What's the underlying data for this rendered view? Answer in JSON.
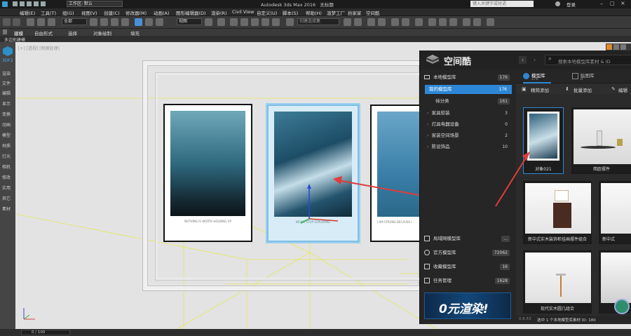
{
  "titlebar": {
    "workspace_label": "工作区: 默认",
    "app_title": "Autodesk 3ds Max 2016",
    "doc_title": "无标题",
    "search_placeholder": "键入关键字或短语",
    "login": "登录"
  },
  "menubar": {
    "items": [
      "编辑(E)",
      "工具(T)",
      "组(G)",
      "视图(V)",
      "创建(C)",
      "修改器(M)",
      "动画(A)",
      "图形编辑器(D)",
      "渲染(R)",
      "Civil View",
      "自定义(U)",
      "脚本(S)",
      "帮助(H)",
      "渲梦工厂",
      "扮家家",
      "空间酷"
    ]
  },
  "toolbar": {
    "filter_value": "全部",
    "view_value": "视图",
    "selset_placeholder": "创建选择集"
  },
  "ribbon": {
    "tabs": [
      "建模",
      "自由形式",
      "选择",
      "对象绘制",
      "填充"
    ],
    "sub_label": "多边形建模"
  },
  "leftpanel": {
    "items": [
      "3DF2",
      "渲染",
      "文件",
      "编辑",
      "显示",
      "变换",
      "动画",
      "模型",
      "材质",
      "灯光",
      "相机",
      "修改",
      "实用",
      "其它",
      "素材"
    ]
  },
  "viewport": {
    "label": "[+] [透视] [明暗处理]",
    "caption_1": "NOTHING IS WORTH HOLDING UP",
    "caption_2": "NEVER STOP EXPLORING",
    "caption_3": "I AM STRONG BECAUSE I..."
  },
  "statusbar": {
    "frame": "0 / 100"
  },
  "plugin": {
    "brand": "空间酷",
    "search_placeholder": "搜索本地模型库素材 & ID",
    "tab_model": "模型库",
    "tab_model_count": "176",
    "tab_texture": "贴图库",
    "tab_texture_count": "0",
    "btn_quick": "精简添加",
    "btn_batch": "批量添加",
    "btn_edit": "编辑",
    "tree": [
      {
        "label": "本地模型库",
        "count": "176"
      },
      {
        "label": "我的模型库",
        "count": "176"
      },
      {
        "label": "待分类",
        "count": "161"
      },
      {
        "label": "家具软装",
        "count": "3"
      },
      {
        "label": "灯具电器设备",
        "count": "0"
      },
      {
        "label": "家装空间场景",
        "count": "2"
      },
      {
        "label": "陈设饰品",
        "count": "10"
      }
    ],
    "bottom": [
      {
        "label": "局域网模型库",
        "count": "..."
      },
      {
        "label": "官方模型库",
        "count": "72062"
      },
      {
        "label": "收藏模型库",
        "count": "16"
      },
      {
        "label": "任务管理",
        "count": "1628"
      }
    ],
    "banner": "0元渲染!",
    "cards": [
      "对象021",
      "简欧摆件",
      "新中式实木装饰柜挂画摆件组合",
      "新中式",
      "现代实木圆几组合",
      ""
    ],
    "version": "0.6.53",
    "status": "选中 1 个本地模型库素材 ID: 180"
  }
}
